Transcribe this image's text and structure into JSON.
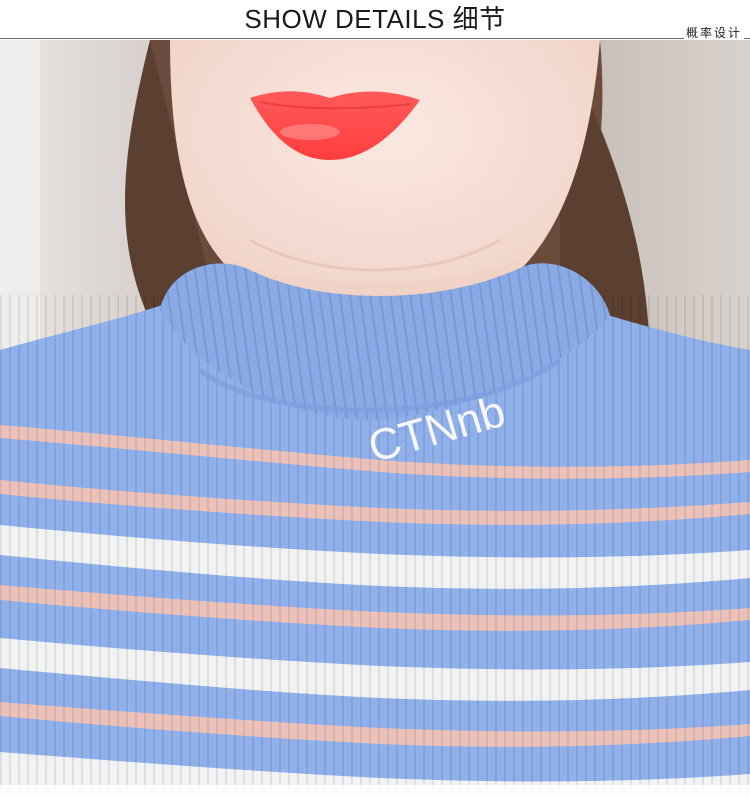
{
  "header": {
    "title": "SHOW DETAILS 细节",
    "tag": "概率设计"
  },
  "photo": {
    "subject": "ribbed-knit-top-closeup",
    "embroidery_text": "CTNnb",
    "colors": {
      "knit_blue": "#8fb0ea",
      "stripe_pink": "#f2c2b8",
      "stripe_white": "#f7f7f4",
      "skin": "#f5ddd3",
      "lips": "#ff4a4a",
      "hair": "#6a4a3a"
    }
  }
}
